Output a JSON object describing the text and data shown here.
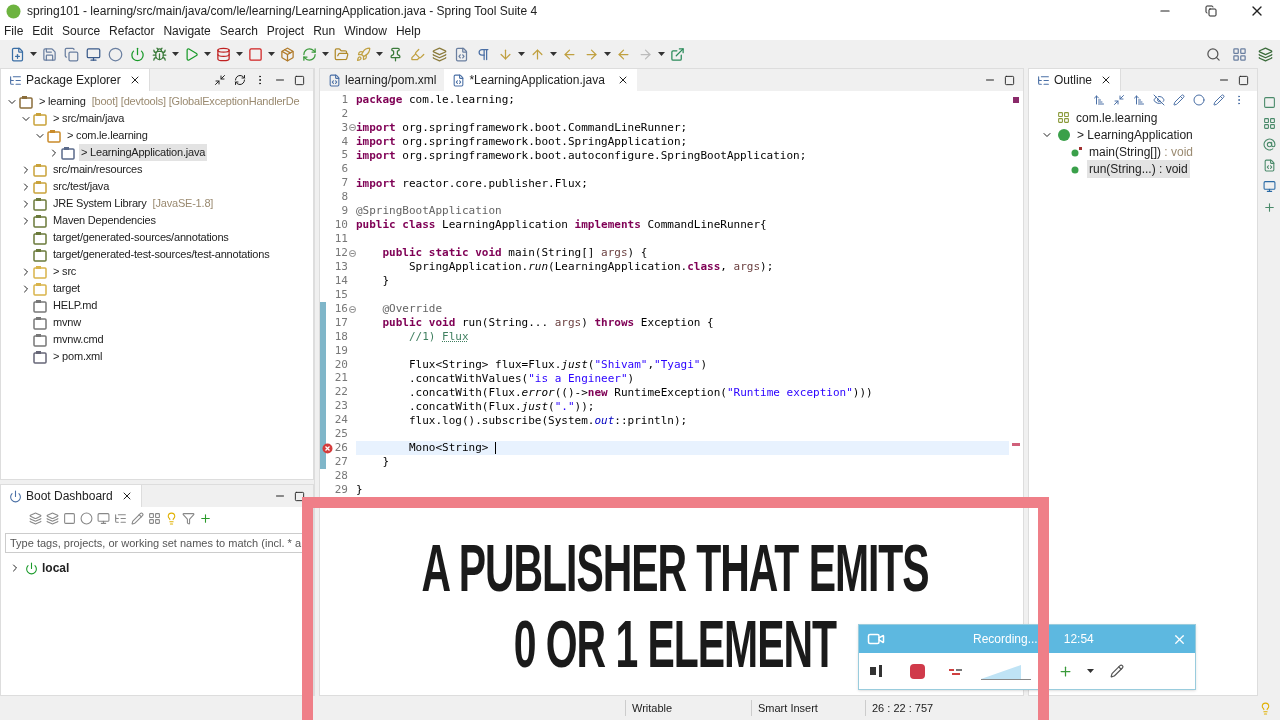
{
  "window": {
    "title": "spring101 - learning/src/main/java/com/le/learning/LearningApplication.java - Spring Tool Suite 4"
  },
  "menu": [
    "File",
    "Edit",
    "Source",
    "Refactor",
    "Navigate",
    "Search",
    "Project",
    "Run",
    "Window",
    "Help"
  ],
  "package_explorer": {
    "title": "Package Explorer",
    "items": [
      {
        "kind": "project",
        "label": "> learning",
        "decoration": "[boot] [devtools] [GlobalExceptionHandlerDe",
        "expanded": true,
        "selected": false,
        "children": [
          {
            "kind": "srcfolder",
            "label": "> src/main/java",
            "expanded": true,
            "selected": false,
            "children": [
              {
                "kind": "package",
                "label": "> com.le.learning",
                "expanded": true,
                "selected": false,
                "children": [
                  {
                    "kind": "javafile",
                    "label": "> LearningApplication.java",
                    "expanded": false,
                    "selected": true
                  }
                ]
              }
            ]
          },
          {
            "kind": "srcfolder",
            "label": "src/main/resources",
            "expanded": false,
            "selected": false
          },
          {
            "kind": "srcfolder",
            "label": "src/test/java",
            "expanded": false,
            "selected": false
          },
          {
            "kind": "library",
            "label": "JRE System Library",
            "decoration": "[JavaSE-1.8]",
            "expanded": false,
            "selected": false
          },
          {
            "kind": "library",
            "label": "Maven Dependencies",
            "expanded": false,
            "selected": false
          },
          {
            "kind": "genfolder",
            "label": "target/generated-sources/annotations",
            "selected": false
          },
          {
            "kind": "genfolder",
            "label": "target/generated-test-sources/test-annotations",
            "selected": false
          },
          {
            "kind": "folder",
            "label": "> src",
            "expanded": false,
            "selected": false
          },
          {
            "kind": "folder",
            "label": "target",
            "expanded": false,
            "selected": false
          },
          {
            "kind": "file",
            "label": "HELP.md",
            "selected": false
          },
          {
            "kind": "file",
            "label": "mvnw",
            "selected": false
          },
          {
            "kind": "file",
            "label": "mvnw.cmd",
            "selected": false
          },
          {
            "kind": "xmlfile",
            "label": "> pom.xml",
            "selected": false
          }
        ]
      }
    ]
  },
  "boot_dashboard": {
    "title": "Boot Dashboard",
    "filter": {
      "placeholder": "Type tags, projects, or working set names to match (incl. * a"
    },
    "items": [
      {
        "label": "local",
        "expanded": false
      }
    ]
  },
  "editor": {
    "tabs": [
      {
        "label": "learning/pom.xml",
        "selected": false
      },
      {
        "label": "*LearningApplication.java",
        "selected": true
      }
    ],
    "lines": [
      {
        "n": "1",
        "t": [
          {
            "kind": "k",
            "text": "package"
          },
          {
            "kind": "p",
            "text": " com.le.learning;"
          }
        ],
        "fold": false,
        "changed": false,
        "error": false,
        "current": false
      },
      {
        "n": "2",
        "fold": false,
        "changed": false,
        "error": false,
        "current": false
      },
      {
        "n": "3",
        "t": [
          {
            "kind": "k",
            "text": "import"
          },
          {
            "kind": "p",
            "text": " org.springframework.boot.CommandLineRunner;"
          }
        ],
        "fold": true,
        "changed": false,
        "error": false,
        "current": false
      },
      {
        "n": "4",
        "t": [
          {
            "kind": "k",
            "text": "import"
          },
          {
            "kind": "p",
            "text": " org.springframework.boot.SpringApplication;"
          }
        ],
        "fold": false,
        "changed": false,
        "error": false,
        "current": false
      },
      {
        "n": "5",
        "t": [
          {
            "kind": "k",
            "text": "import"
          },
          {
            "kind": "p",
            "text": " org.springframework.boot.autoconfigure.SpringBootApplication;"
          }
        ],
        "fold": false,
        "changed": false,
        "error": false,
        "current": false
      },
      {
        "n": "6",
        "fold": false,
        "changed": false,
        "error": false,
        "current": false
      },
      {
        "n": "7",
        "t": [
          {
            "kind": "k",
            "text": "import"
          },
          {
            "kind": "p",
            "text": " reactor.core.publisher.Flux;"
          }
        ],
        "fold": false,
        "changed": false,
        "error": false,
        "current": false
      },
      {
        "n": "8",
        "fold": false,
        "changed": false,
        "error": false,
        "current": false
      },
      {
        "n": "9",
        "t": [
          {
            "kind": "a",
            "text": "@SpringBootApplication"
          }
        ],
        "fold": false,
        "changed": false,
        "error": false,
        "current": false
      },
      {
        "n": "10",
        "t": [
          {
            "kind": "k",
            "text": "public class"
          },
          {
            "kind": "p",
            "text": " LearningApplication "
          },
          {
            "kind": "k",
            "text": "implements"
          },
          {
            "kind": "p",
            "text": " CommandLineRunner{"
          }
        ],
        "fold": false,
        "changed": false,
        "error": false,
        "current": false
      },
      {
        "n": "11",
        "fold": false,
        "changed": false,
        "error": false,
        "current": false
      },
      {
        "n": "12",
        "t": [
          {
            "kind": "k",
            "text": "    public static void"
          },
          {
            "kind": "p",
            "text": " main(String[] "
          },
          {
            "kind": "v",
            "text": "args"
          },
          {
            "kind": "p",
            "text": ") {"
          }
        ],
        "fold": true,
        "changed": false,
        "error": false,
        "current": false
      },
      {
        "n": "13",
        "t": [
          {
            "kind": "p",
            "text": "        SpringApplication."
          },
          {
            "kind": "i",
            "text": "run"
          },
          {
            "kind": "p",
            "text": "(LearningApplication."
          },
          {
            "kind": "k",
            "text": "class"
          },
          {
            "kind": "p",
            "text": ", "
          },
          {
            "kind": "v",
            "text": "args"
          },
          {
            "kind": "p",
            "text": ");"
          }
        ],
        "fold": false,
        "changed": false,
        "error": false,
        "current": false
      },
      {
        "n": "14",
        "t": [
          {
            "kind": "p",
            "text": "    }"
          }
        ],
        "fold": false,
        "changed": false,
        "error": false,
        "current": false
      },
      {
        "n": "15",
        "fold": false,
        "changed": false,
        "error": false,
        "current": false
      },
      {
        "n": "16",
        "t": [
          {
            "kind": "a",
            "text": "    @Override"
          }
        ],
        "fold": true,
        "changed": true,
        "error": false,
        "current": false
      },
      {
        "n": "17",
        "t": [
          {
            "kind": "k",
            "text": "    public void"
          },
          {
            "kind": "p",
            "text": " run(String... "
          },
          {
            "kind": "v",
            "text": "args"
          },
          {
            "kind": "p",
            "text": ") "
          },
          {
            "kind": "k",
            "text": "throws"
          },
          {
            "kind": "p",
            "text": " Exception {"
          }
        ],
        "fold": false,
        "changed": true,
        "error": false,
        "current": false
      },
      {
        "n": "18",
        "t": [
          {
            "kind": "c",
            "text": "        //1) "
          },
          {
            "kind": "u",
            "text": "Flux"
          }
        ],
        "fold": false,
        "changed": true,
        "error": false,
        "current": false
      },
      {
        "n": "19",
        "fold": false,
        "changed": true,
        "error": false,
        "current": false
      },
      {
        "n": "20",
        "t": [
          {
            "kind": "p",
            "text": "        Flux<String> flux=Flux."
          },
          {
            "kind": "i",
            "text": "just"
          },
          {
            "kind": "p",
            "text": "("
          },
          {
            "kind": "s",
            "text": "\"Shivam\""
          },
          {
            "kind": "p",
            "text": ","
          },
          {
            "kind": "s",
            "text": "\"Tyagi\""
          },
          {
            "kind": "p",
            "text": ")"
          }
        ],
        "fold": false,
        "changed": true,
        "error": false,
        "current": false
      },
      {
        "n": "21",
        "t": [
          {
            "kind": "p",
            "text": "        .concatWithValues("
          },
          {
            "kind": "s",
            "text": "\"is a Engineer\""
          },
          {
            "kind": "p",
            "text": ")"
          }
        ],
        "fold": false,
        "changed": true,
        "error": false,
        "current": false
      },
      {
        "n": "22",
        "t": [
          {
            "kind": "p",
            "text": "        .concatWith(Flux."
          },
          {
            "kind": "i",
            "text": "error"
          },
          {
            "kind": "p",
            "text": "(()->"
          },
          {
            "kind": "k",
            "text": "new"
          },
          {
            "kind": "p",
            "text": " RuntimeException("
          },
          {
            "kind": "s",
            "text": "\"Runtime exception\""
          },
          {
            "kind": "p",
            "text": ")))"
          }
        ],
        "fold": false,
        "changed": true,
        "error": false,
        "current": false
      },
      {
        "n": "23",
        "t": [
          {
            "kind": "p",
            "text": "        .concatWith(Flux."
          },
          {
            "kind": "i",
            "text": "just"
          },
          {
            "kind": "p",
            "text": "("
          },
          {
            "kind": "s",
            "text": "\".\""
          },
          {
            "kind": "p",
            "text": "));"
          }
        ],
        "fold": false,
        "changed": true,
        "error": false,
        "current": false
      },
      {
        "n": "24",
        "t": [
          {
            "kind": "p",
            "text": "        flux.log().subscribe(System."
          },
          {
            "kind": "f",
            "text": "out"
          },
          {
            "kind": "p",
            "text": "::println);"
          }
        ],
        "fold": false,
        "changed": true,
        "error": false,
        "current": false
      },
      {
        "n": "25",
        "fold": false,
        "changed": true,
        "error": false,
        "current": false
      },
      {
        "n": "26",
        "t": [
          {
            "kind": "p",
            "text": "        Mono<String>"
          }
        ],
        "fold": false,
        "changed": true,
        "error": true,
        "current": true
      },
      {
        "n": "27",
        "t": [
          {
            "kind": "p",
            "text": "    }"
          }
        ],
        "fold": false,
        "changed": true,
        "error": false,
        "current": false
      },
      {
        "n": "28",
        "fold": false,
        "changed": false,
        "error": false,
        "current": false
      },
      {
        "n": "29",
        "t": [
          {
            "kind": "p",
            "text": "}"
          }
        ],
        "fold": false,
        "changed": false,
        "error": false,
        "current": false
      }
    ]
  },
  "outline": {
    "title": "Outline",
    "items": [
      {
        "kind": "package",
        "label": "com.le.learning",
        "selected": false
      },
      {
        "kind": "class",
        "label": "> LearningApplication",
        "expanded": true,
        "selected": false,
        "children": [
          {
            "kind": "static-method",
            "label": "main(String[])",
            "type": " : void",
            "selected": false
          },
          {
            "kind": "method",
            "label": "run(String...)",
            "type": " : void",
            "selected": true
          }
        ]
      }
    ]
  },
  "status_bar": [
    "Writable",
    "Smart Insert",
    "26 : 22 : 757"
  ],
  "caption": [
    "A PUBLISHER THAT EMITS",
    "0 OR 1 ELEMENT"
  ],
  "recorder": {
    "status": "Recording...",
    "time": "12:54",
    "level": 0.8
  }
}
